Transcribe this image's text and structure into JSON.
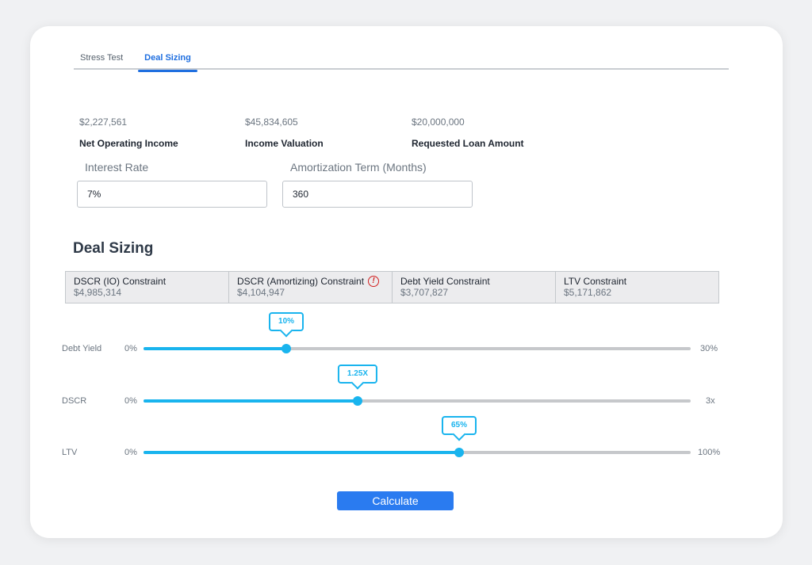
{
  "tabs": [
    {
      "label": "Stress Test",
      "active": false
    },
    {
      "label": "Deal Sizing",
      "active": true
    }
  ],
  "metrics": [
    {
      "value": "$2,227,561",
      "label": "Net Operating Income"
    },
    {
      "value": "$45,834,605",
      "label": "Income Valuation"
    },
    {
      "value": "$20,000,000",
      "label": "Requested Loan Amount"
    }
  ],
  "fields": {
    "interest_rate": {
      "label": "Interest Rate",
      "value": "7%"
    },
    "amortization": {
      "label": "Amortization Term (Months)",
      "value": "360"
    }
  },
  "section_title": "Deal Sizing",
  "constraints": [
    {
      "name": "DSCR (IO) Constraint",
      "value": "$4,985,314",
      "icon": null
    },
    {
      "name": "DSCR (Amortizing) Constraint",
      "value": "$4,104,947",
      "icon": "warning-icon",
      "icon_glyph": "!"
    },
    {
      "name": "Debt Yield Constraint",
      "value": "$3,707,827",
      "icon": null
    },
    {
      "name": "LTV Constraint",
      "value": "$5,171,862",
      "icon": null
    }
  ],
  "sliders": [
    {
      "label": "Debt Yield",
      "min": "0%",
      "max": "30%",
      "bubble": "10%",
      "fraction": 0.2609
    },
    {
      "label": "DSCR",
      "min": "0%",
      "max": "3x",
      "bubble": "1.25X",
      "fraction": 0.3913
    },
    {
      "label": "LTV",
      "min": "0%",
      "max": "100%",
      "bubble": "65%",
      "fraction": 0.5768
    }
  ],
  "calculate_label": "Calculate",
  "colors": {
    "accent": "#1f6fe0",
    "slider": "#19b4ee",
    "button": "#2a7bf0",
    "warning": "#d21f1f"
  }
}
